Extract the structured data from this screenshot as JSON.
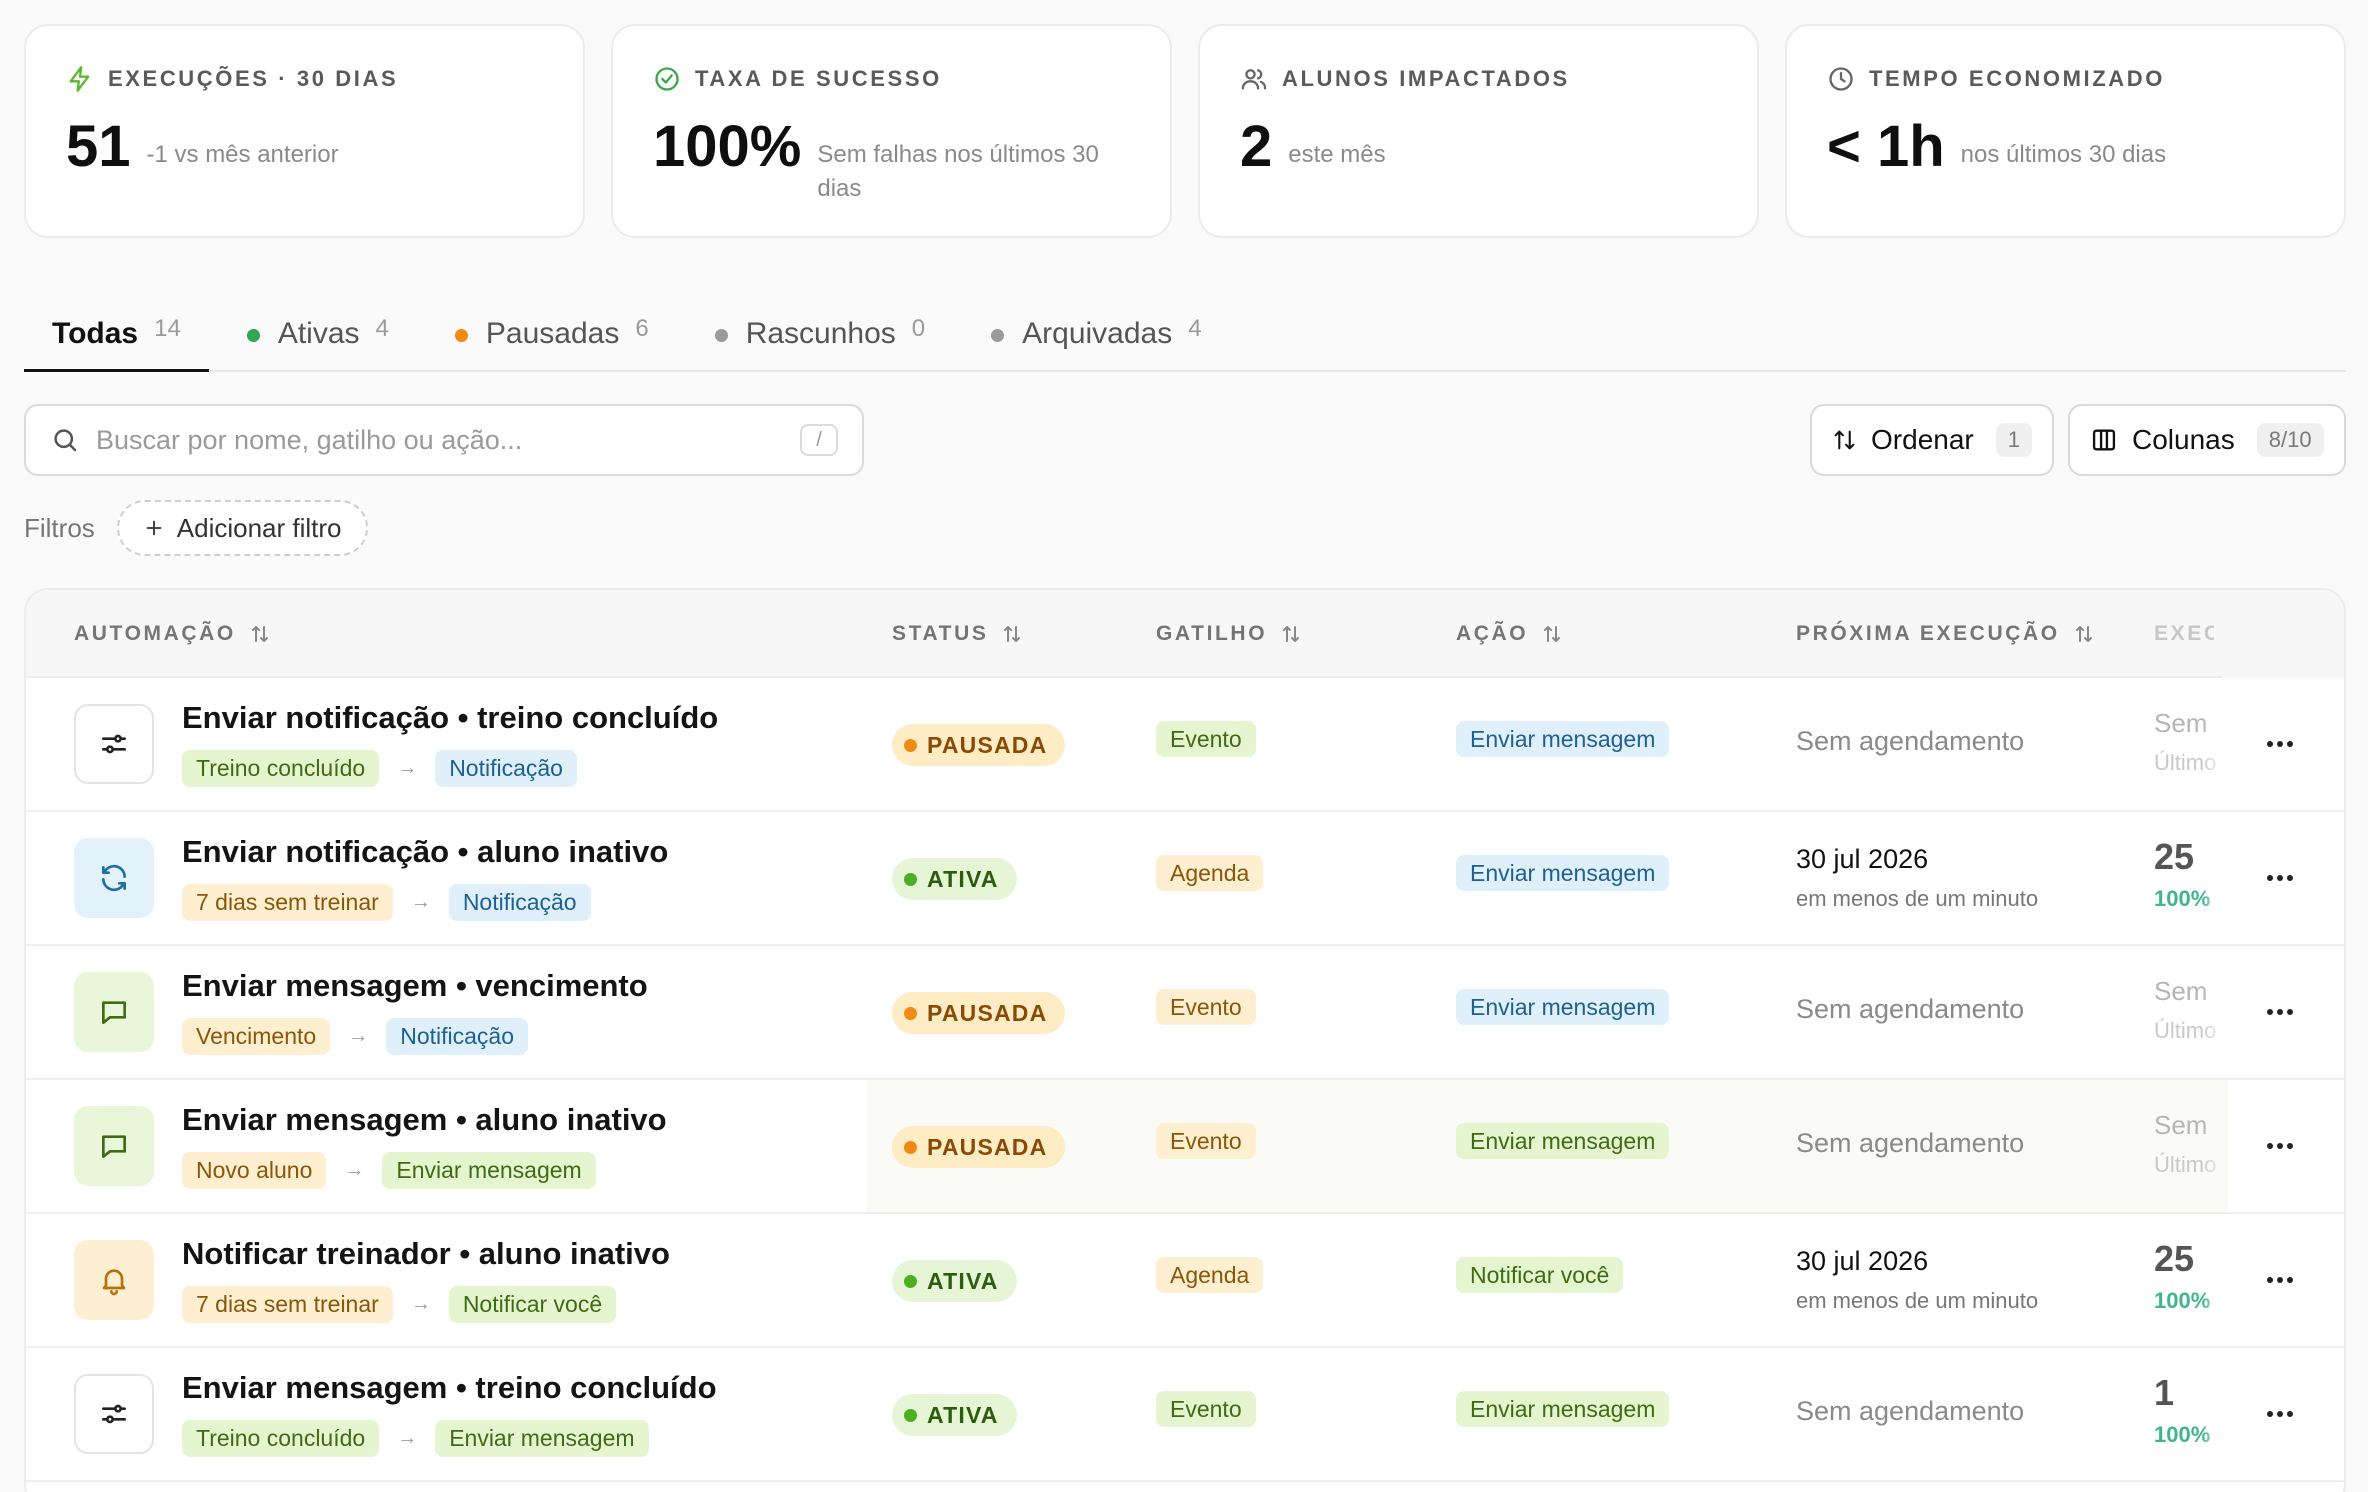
{
  "stats": [
    {
      "label": "EXECUÇÕES · 30 DIAS",
      "value": "51",
      "sub": "-1 vs mês anterior",
      "icon": "lightning-icon",
      "color": "#5cb82e"
    },
    {
      "label": "TAXA DE SUCESSO",
      "value": "100%",
      "sub": "Sem falhas nos últimos 30 dias",
      "icon": "check-circle-icon",
      "color": "#3aa84a"
    },
    {
      "label": "ALUNOS IMPACTADOS",
      "value": "2",
      "sub": "este mês",
      "icon": "users-icon",
      "color": "#666666"
    },
    {
      "label": "TEMPO ECONOMIZADO",
      "value": "< 1h",
      "sub": "nos últimos 30 dias",
      "icon": "clock-icon",
      "color": "#666666"
    }
  ],
  "tabs": [
    {
      "label": "Todas",
      "count": "14",
      "dot": null
    },
    {
      "label": "Ativas",
      "count": "4",
      "dot": "#2fa84f"
    },
    {
      "label": "Pausadas",
      "count": "6",
      "dot": "#f08a12"
    },
    {
      "label": "Rascunhos",
      "count": "0",
      "dot": "#9a9a9a"
    },
    {
      "label": "Arquivadas",
      "count": "4",
      "dot": "#9a9a9a"
    }
  ],
  "search": {
    "placeholder": "Buscar por nome, gatilho ou ação...",
    "shortcut": "/"
  },
  "toolbar": {
    "sort_label": "Ordenar",
    "sort_count": "1",
    "columns_label": "Colunas",
    "columns_count": "8/10"
  },
  "filters": {
    "label": "Filtros",
    "add_label": "Adicionar filtro"
  },
  "table": {
    "columns": [
      "AUTOMAÇÃO",
      "STATUS",
      "GATILHO",
      "AÇÃO",
      "PRÓXIMA EXECUÇÃO",
      "EXECUÇÕES"
    ],
    "rows": [
      {
        "icon": "sliders-icon",
        "title": "Enviar notificação • treino concluído",
        "from": "Treino concluído",
        "to": "Notificação",
        "status": "PAUSADA",
        "trigger": "Evento",
        "action": "Enviar mensagem",
        "next": "Sem agendamento",
        "next_sub": "",
        "exec": "Sem",
        "exec_sub": "Último"
      },
      {
        "icon": "refresh-icon",
        "title": "Enviar notificação • aluno inativo",
        "from": "7 dias sem treinar",
        "to": "Notificação",
        "status": "ATIVA",
        "trigger": "Agenda",
        "action": "Enviar mensagem",
        "next": "30 jul 2026",
        "next_sub": "em menos de um minuto",
        "exec": "25",
        "exec_sub": "100%"
      },
      {
        "icon": "message-icon",
        "title": "Enviar mensagem • vencimento",
        "from": "Vencimento",
        "to": "Notificação",
        "status": "PAUSADA",
        "trigger": "Evento",
        "action": "Enviar mensagem",
        "next": "Sem agendamento",
        "next_sub": "",
        "exec": "Sem",
        "exec_sub": "Último"
      },
      {
        "icon": "message-icon",
        "title": "Enviar mensagem • aluno inativo",
        "from": "Novo aluno",
        "to": "Enviar mensagem",
        "status": "PAUSADA",
        "trigger": "Evento",
        "action": "Enviar mensagem",
        "next": "Sem agendamento",
        "next_sub": "",
        "exec": "Sem",
        "exec_sub": "Último"
      },
      {
        "icon": "bell-icon",
        "title": "Notificar treinador • aluno inativo",
        "from": "7 dias sem treinar",
        "to": "Notificar você",
        "status": "ATIVA",
        "trigger": "Agenda",
        "action": "Notificar você",
        "next": "30 jul 2026",
        "next_sub": "em menos de um minuto",
        "exec": "25",
        "exec_sub": "100%"
      },
      {
        "icon": "sliders-icon",
        "title": "Enviar mensagem • treino concluído",
        "from": "Treino concluído",
        "to": "Enviar mensagem",
        "status": "ATIVA",
        "trigger": "Evento",
        "action": "Enviar mensagem",
        "next": "Sem agendamento",
        "next_sub": "",
        "exec": "1",
        "exec_sub": "100%"
      }
    ]
  }
}
